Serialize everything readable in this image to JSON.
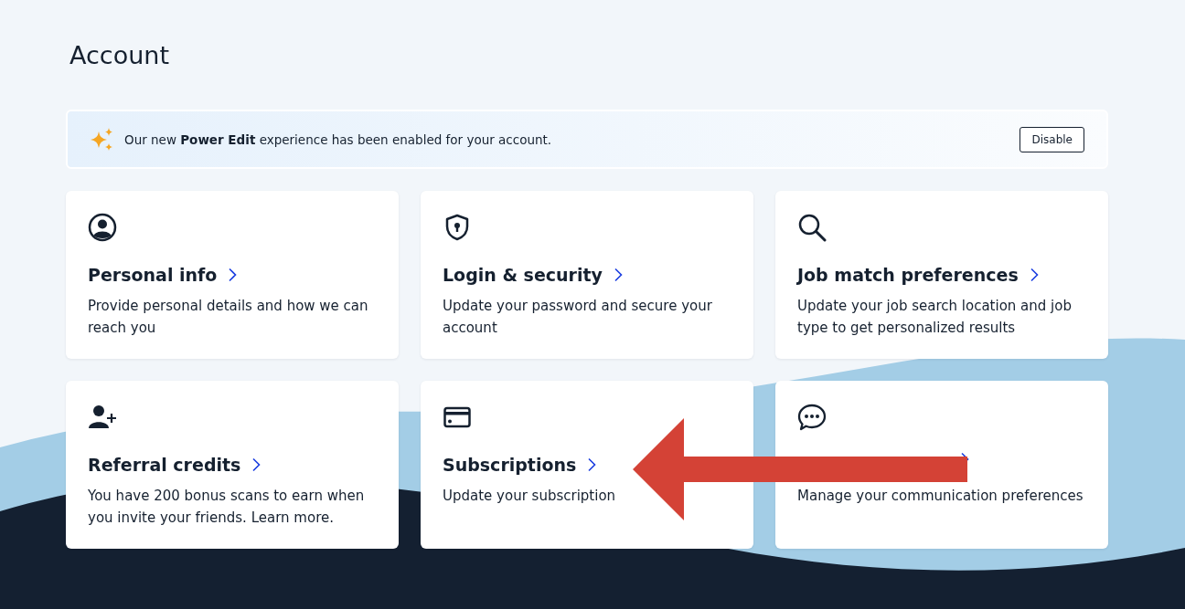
{
  "page": {
    "title": "Account"
  },
  "banner": {
    "message": "Our new **Power Edit** experience has been enabled for your account.",
    "button": "Disable"
  },
  "cards": [
    {
      "kind": "person",
      "title": "Personal info",
      "description": "Provide personal details and how we can reach you"
    },
    {
      "kind": "shield",
      "title": "Login & security",
      "description": "Update your password and secure your account"
    },
    {
      "kind": "search",
      "title": "Job match preferences",
      "description": "Update your job search location and job type to get personalized results"
    },
    {
      "kind": "person-add",
      "title": "Referral credits",
      "description": "You have 200 bonus scans to earn when you invite your friends. Learn more."
    },
    {
      "kind": "card",
      "title": "Subscriptions",
      "description": "Update your subscription"
    },
    {
      "kind": "chat",
      "description": "Manage your communication preferences"
    }
  ],
  "annotation": {
    "kind": "arrow"
  }
}
